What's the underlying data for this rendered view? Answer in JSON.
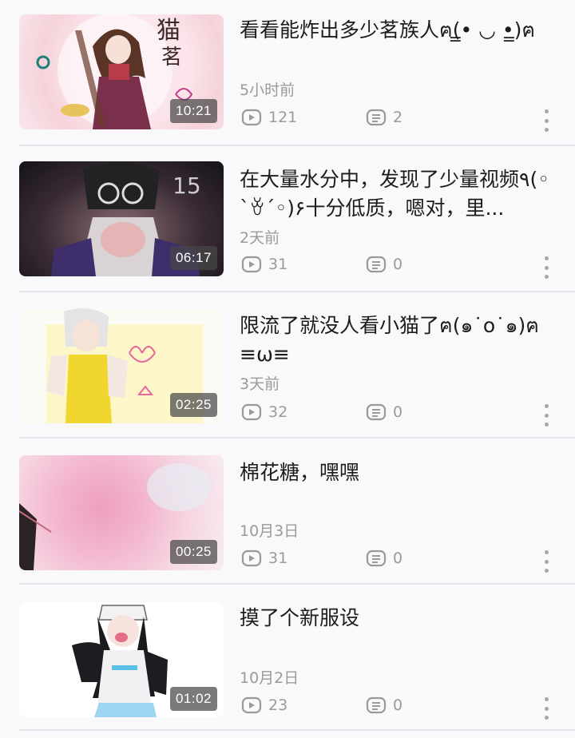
{
  "videos": [
    {
      "title": "看看能炸出多少茗族人ฅ(̳• ◡ •̳)ฅ",
      "date": "5小时前",
      "plays": "121",
      "comments": "2",
      "duration": "10:21",
      "thumb_icon": "anime-girl-tea-thumbnail"
    },
    {
      "title": "在大量水分中，发现了少量视频٩(◦`ꈊ´◦)۶十分低质，嗯对，里...",
      "date": "2天前",
      "plays": "31",
      "comments": "0",
      "duration": "06:17",
      "thumb_icon": "anime-boy-glasses-thumbnail"
    },
    {
      "title": "限流了就没人看小猫了ฅ(๑˙o˙๑)ฅ≡ω≡",
      "date": "3天前",
      "plays": "32",
      "comments": "0",
      "duration": "02:25",
      "thumb_icon": "cat-girl-yellow-thumbnail"
    },
    {
      "title": "棉花糖，嘿嘿",
      "date": "10月3日",
      "plays": "31",
      "comments": "0",
      "duration": "00:25",
      "thumb_icon": "pink-blur-thumbnail"
    },
    {
      "title": "摸了个新服设",
      "date": "10月2日",
      "plays": "23",
      "comments": "0",
      "duration": "01:02",
      "thumb_icon": "girl-cap-outfit-thumbnail"
    }
  ],
  "icons": {
    "plays": "play-count-icon",
    "comments": "comment-count-icon",
    "more": "more-vertical-icon"
  },
  "colors": {
    "meta_text": "#9a9a9a",
    "title_text": "#1c1c1c",
    "divider": "#e4e4e8",
    "background": "#f9f9fb"
  }
}
